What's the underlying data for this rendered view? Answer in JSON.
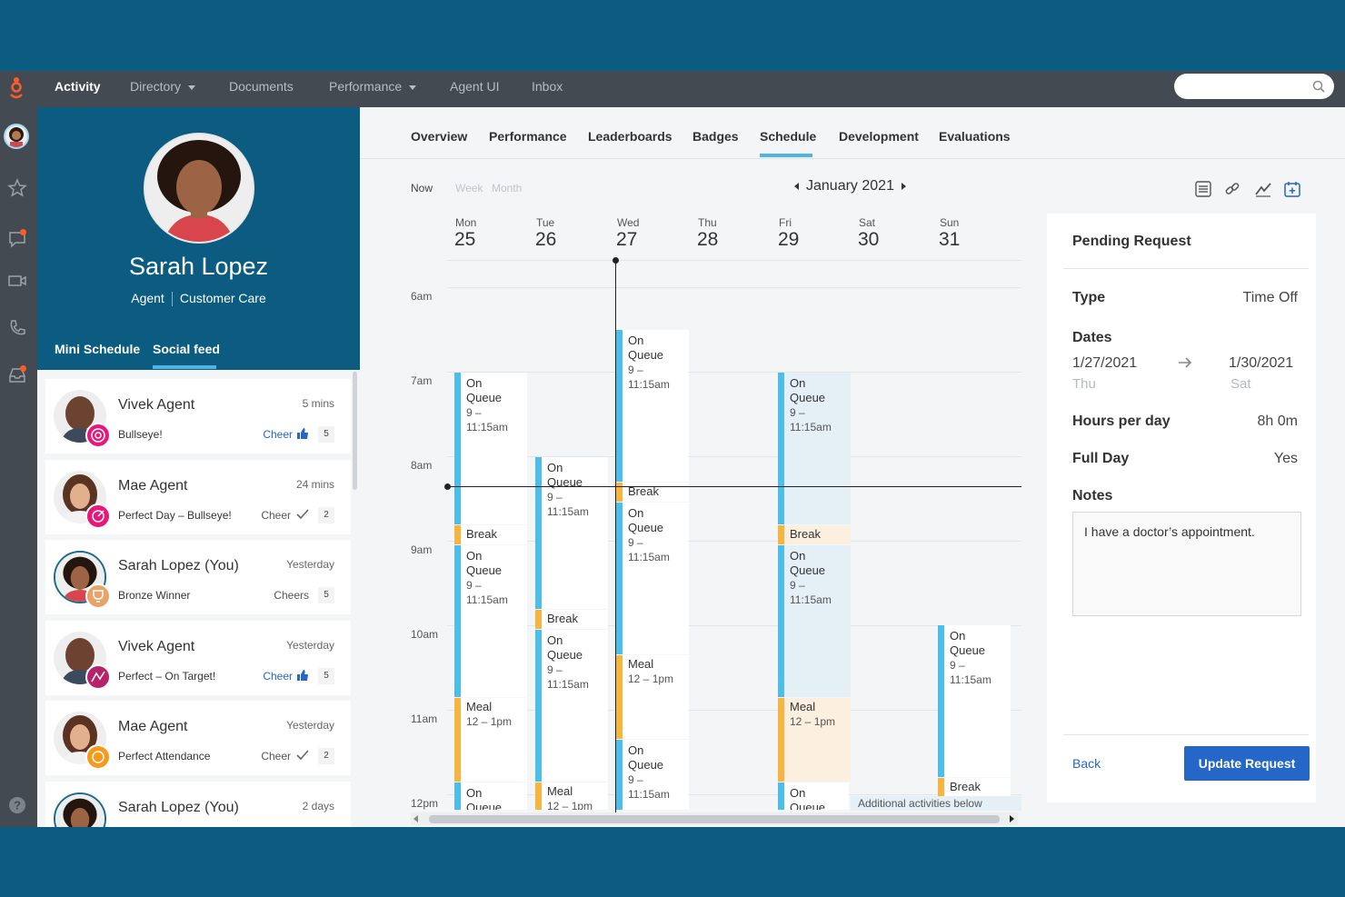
{
  "nav": {
    "items": [
      {
        "label": "Activity"
      },
      {
        "label": "Directory"
      },
      {
        "label": "Documents"
      },
      {
        "label": "Performance"
      },
      {
        "label": "Agent UI"
      },
      {
        "label": "Inbox"
      }
    ],
    "search_placeholder": ""
  },
  "profile": {
    "name": "Sarah Lopez",
    "role": "Agent",
    "department": "Customer Care",
    "tabs": [
      "Mini Schedule",
      "Social feed"
    ]
  },
  "feed": [
    {
      "name": "Vivek Agent",
      "time": "5 mins",
      "achievement": "Bullseye!",
      "cheer": "Cheer",
      "count": "5"
    },
    {
      "name": "Mae Agent",
      "time": "24 mins",
      "achievement": "Perfect Day – Bullseye!",
      "cheer": "Cheer",
      "count": "2"
    },
    {
      "name": "Sarah Lopez (You)",
      "time": "Yesterday",
      "achievement": "Bronze Winner",
      "cheer": "Cheers",
      "count": "5"
    },
    {
      "name": "Vivek Agent",
      "time": "Yesterday",
      "achievement": "Perfect – On Target!",
      "cheer": "Cheer",
      "count": "5"
    },
    {
      "name": "Mae Agent",
      "time": "Yesterday",
      "achievement": "Perfect Attendance",
      "cheer": "Cheer",
      "count": "2"
    },
    {
      "name": "Sarah Lopez (You)",
      "time": "2 days",
      "achievement": "",
      "cheer": "",
      "count": ""
    }
  ],
  "subtabs": [
    "Overview",
    "Performance",
    "Leaderboards",
    "Badges",
    "Schedule",
    "Development",
    "Evaluations"
  ],
  "schedule": {
    "now": "Now",
    "week": "Week",
    "month_view": "Month",
    "month": "January 2021",
    "days": [
      {
        "name": "Mon",
        "num": "25"
      },
      {
        "name": "Tue",
        "num": "26"
      },
      {
        "name": "Wed",
        "num": "27"
      },
      {
        "name": "Thu",
        "num": "28"
      },
      {
        "name": "Fri",
        "num": "29"
      },
      {
        "name": "Sat",
        "num": "30"
      },
      {
        "name": "Sun",
        "num": "31"
      }
    ],
    "hours": [
      "6am",
      "7am",
      "8am",
      "9am",
      "10am",
      "11am",
      "12pm"
    ],
    "on_queue_a": "On",
    "on_queue_b": "Queue",
    "oq_time_a": "9 –",
    "oq_time_b": "11:15am",
    "break": "Break",
    "meal": "Meal",
    "meal_time": "12 – 1pm",
    "meal_time_cut": "12 – 1pm",
    "additional": "Additional activities below"
  },
  "pending": {
    "title": "Pending Request",
    "type_label": "Type",
    "type_value": "Time Off",
    "dates_label": "Dates",
    "start_date": "1/27/2021",
    "start_dow": "Thu",
    "end_date": "1/30/2021",
    "end_dow": "Sat",
    "hours_label": "Hours per day",
    "hours_value": "8h 0m",
    "fullday_label": "Full Day",
    "fullday_value": "Yes",
    "notes_label": "Notes",
    "notes": "I have a doctor’s appointment.",
    "back": "Back",
    "update": "Update Request"
  },
  "colors": {
    "brand": "#0b5c80",
    "nav": "#444a51",
    "queue": "#4dbde9",
    "break": "#f5b53f",
    "primary": "#2566c9"
  }
}
